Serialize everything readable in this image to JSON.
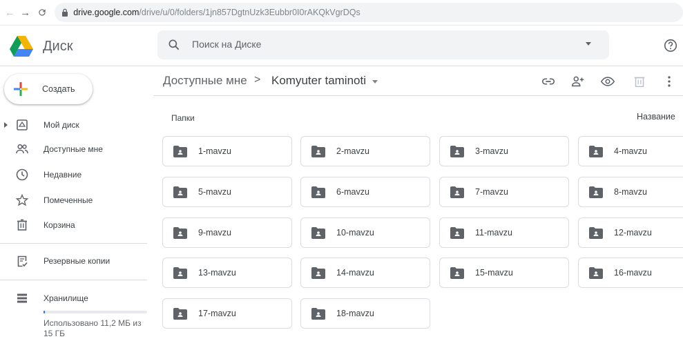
{
  "browser": {
    "url_host": "drive.google.com",
    "url_path": "/drive/u/0/folders/1jn857DgtnUzk3Eubbr0I0rAKQkVgrDQs"
  },
  "app": {
    "name": "Диск"
  },
  "search": {
    "placeholder": "Поиск на Диске"
  },
  "sidebar": {
    "create_label": "Создать",
    "items": [
      {
        "label": "Мой диск",
        "icon": "my-drive-icon"
      },
      {
        "label": "Доступные мне",
        "icon": "shared-with-me-icon"
      },
      {
        "label": "Недавние",
        "icon": "clock-icon"
      },
      {
        "label": "Помеченные",
        "icon": "star-icon"
      },
      {
        "label": "Корзина",
        "icon": "trash-icon"
      },
      {
        "label": "Резервные копии",
        "icon": "backup-icon"
      },
      {
        "label": "Хранилище",
        "icon": "storage-icon"
      }
    ],
    "storage_text": "Использовано 11,2 МБ из 15 ГБ",
    "storage_used_fraction": 0.0007
  },
  "breadcrumb": {
    "parent": "Доступные мне",
    "separator": ">",
    "current": "Komyuter taminoti"
  },
  "main": {
    "section_label": "Папки",
    "sort_label": "Название",
    "folders": [
      "1-mavzu",
      "2-mavzu",
      "3-mavzu",
      "4-mavzu",
      "5-mavzu",
      "6-mavzu",
      "7-mavzu",
      "8-mavzu",
      "9-mavzu",
      "10-mavzu",
      "11-mavzu",
      "12-mavzu",
      "13-mavzu",
      "14-mavzu",
      "15-mavzu",
      "16-mavzu",
      "17-mavzu",
      "18-mavzu"
    ]
  },
  "colors": {
    "accent_blue": "#1a73e8",
    "drive_green": "#0f9d58",
    "drive_yellow": "#f4b400",
    "drive_blue": "#4285f4",
    "icon_gray": "#5f6368"
  }
}
